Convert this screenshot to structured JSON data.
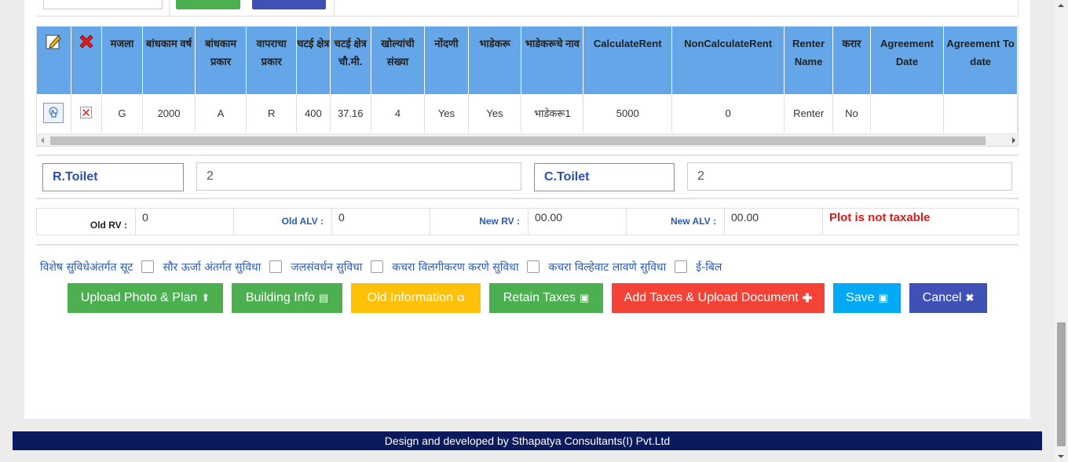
{
  "table": {
    "headers": [
      "",
      "",
      "मजला",
      "बांधकाम वर्ष",
      "बांधकाम प्रकार",
      "वापराचा प्रकार",
      "चटई क्षेत्र",
      "चटई क्षेत्र चौ.मी.",
      "खोल्यांची संख्या",
      "नोंदणी",
      "भाडेकरू",
      "भाडेकरूचे नाव",
      "CalculateRent",
      "NonCalculateRent",
      "Renter Name",
      "करार",
      "Agreement Date",
      "Agreement To date"
    ],
    "row": [
      "",
      "",
      "G",
      "2000",
      "A",
      "R",
      "400",
      "37.16",
      "4",
      "Yes",
      "Yes",
      "भाडेकरू1",
      "5000",
      "0",
      "Renter",
      "No",
      "",
      ""
    ],
    "edit_icon": "edit-pencil-icon",
    "delete_icon": "delete-x-icon"
  },
  "toilets": {
    "r_label": "R.Toilet",
    "r_value": "2",
    "c_label": "C.Toilet",
    "c_value": "2"
  },
  "rv": {
    "old_rv_label": "Old RV :",
    "old_rv_value": "0",
    "old_alv_label": "Old ALV :",
    "old_alv_value": "0",
    "new_rv_label": "New RV :",
    "new_rv_value": "00.00",
    "new_alv_label": "New ALV :",
    "new_alv_value": "00.00",
    "plot_status": "Plot is not taxable"
  },
  "checkboxes": [
    "विशेष सुविधेअंतर्गत सूट",
    "सौर ऊर्जा अंतर्गत सुविधा",
    "जलसंवर्धन सुविधा",
    "कचरा विलगीकरण करणे सुविधा",
    "कचरा विल्हेवाट लावणे सुविधा",
    "ई-बिल"
  ],
  "buttons": {
    "upload": "Upload Photo & Plan",
    "building": "Building Info",
    "old": "Old Information",
    "retain": "Retain Taxes",
    "add": "Add Taxes & Upload Document",
    "save": "Save",
    "cancel": "Cancel"
  },
  "colors": {
    "header_blue": "#64a6e8",
    "green": "#4caf50",
    "amber": "#ffc107",
    "red": "#f44336",
    "cyan": "#03a9f4",
    "indigo": "#3f51b5",
    "footer": "#0b1a5c",
    "status_red": "#e01919"
  },
  "footer": "Design and developed by Sthapatya Consultants(I) Pvt.Ltd"
}
